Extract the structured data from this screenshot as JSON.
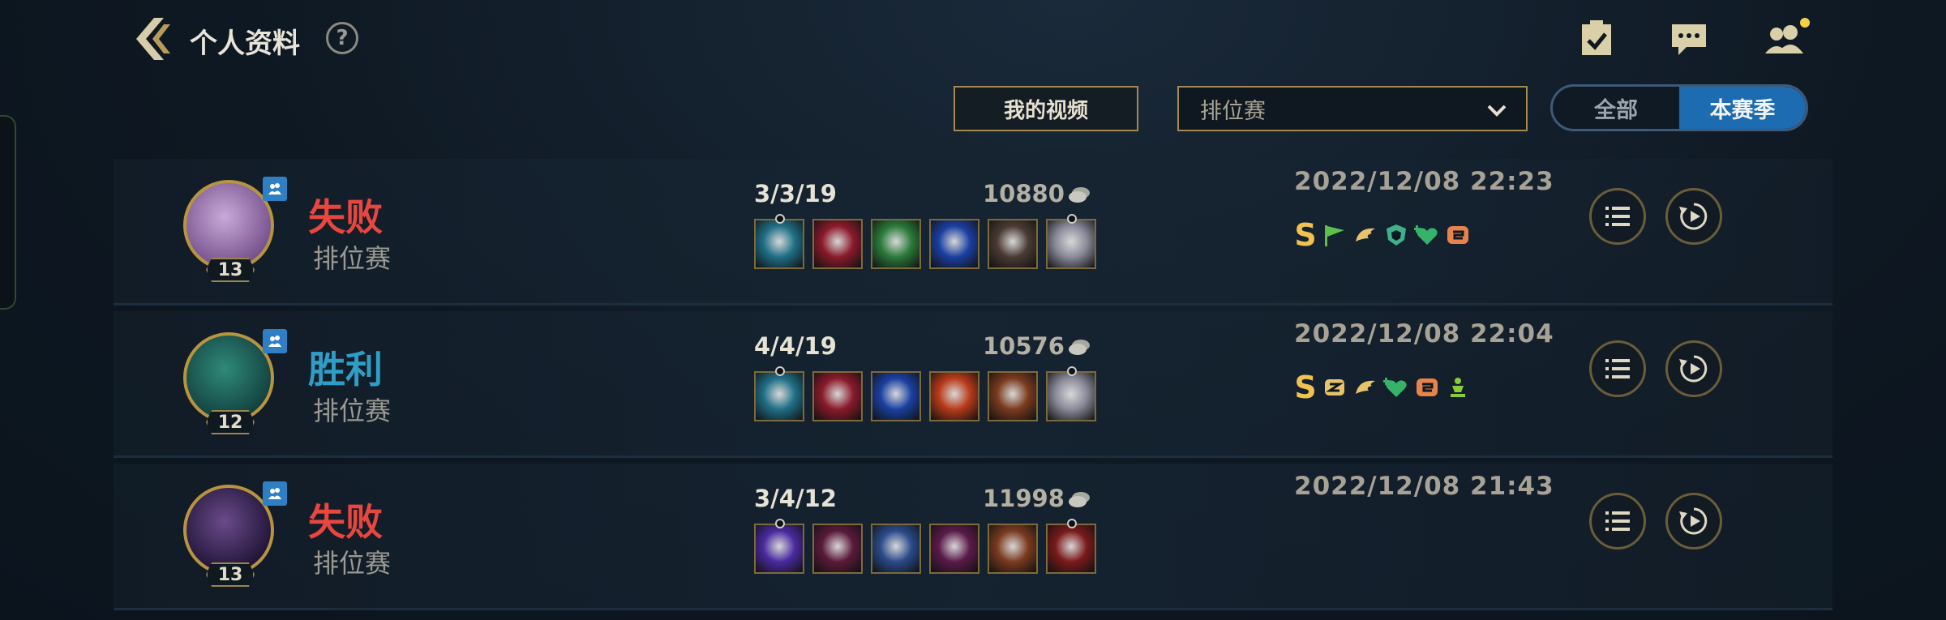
{
  "header": {
    "title": "个人资料",
    "help_label": "?"
  },
  "filters": {
    "my_video_label": "我的视频",
    "mode_selected": "排位赛",
    "season_options": [
      "全部",
      "本赛季"
    ],
    "season_active": "本赛季"
  },
  "matches": [
    {
      "level": "13",
      "result": "失败",
      "result_type": "loss",
      "mode": "排位赛",
      "kda": "3/3/19",
      "gold": "10880",
      "datetime": "2022/12/08 22:23",
      "avatar_colors": [
        "#c9a9d8",
        "#6e4a86"
      ],
      "items": [
        "#1f6f86",
        "#8a1a2a",
        "#2a7a3a",
        "#1a3fa0",
        "#4a3a34",
        "#8a8a9a"
      ],
      "badges": [
        "s",
        "flag",
        "wing",
        "shield",
        "heart",
        "chain"
      ]
    },
    {
      "level": "12",
      "result": "胜利",
      "result_type": "win",
      "mode": "排位赛",
      "kda": "4/4/19",
      "gold": "10576",
      "datetime": "2022/12/08 22:04",
      "avatar_colors": [
        "#2e8a7a",
        "#123a3a"
      ],
      "items": [
        "#1f6f86",
        "#8a1a2a",
        "#1a3fa0",
        "#b83a1a",
        "#7a3a1f",
        "#8a8a9a"
      ],
      "badges": [
        "s",
        "coin",
        "wing",
        "heart",
        "chain",
        "crown"
      ]
    },
    {
      "level": "13",
      "result": "失败",
      "result_type": "loss",
      "mode": "排位赛",
      "kda": "3/4/12",
      "gold": "11998",
      "datetime": "2022/12/08 21:43",
      "avatar_colors": [
        "#6a4a8a",
        "#1a1030"
      ],
      "items": [
        "#4a2aa0",
        "#5a1a3a",
        "#2a4a8a",
        "#5a1a4a",
        "#7a3a1f",
        "#7a1a1a"
      ],
      "badges": []
    }
  ],
  "colors": {
    "gold_border": "#a48a4f",
    "loss": "#e8463e",
    "win": "#2e9ec8",
    "active_toggle": "#1d6bb0"
  },
  "icons": [
    "back-arrow-icon",
    "help-icon",
    "checklist-icon",
    "chat-icon",
    "friends-icon",
    "chevron-down-icon",
    "gold-coin-icon",
    "list-icon",
    "replay-icon",
    "party-icon"
  ]
}
